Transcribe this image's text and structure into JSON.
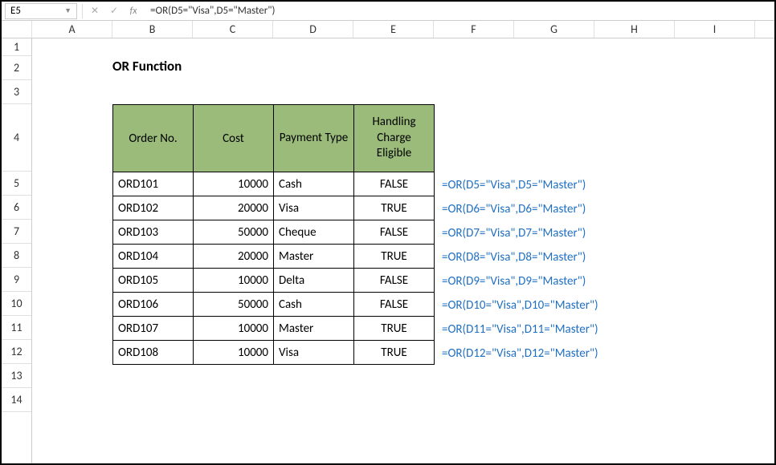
{
  "formulaBar": {
    "nameBox": "E5",
    "formula": "=OR(D5=\"Visa\",D5=\"Master\")"
  },
  "columns": [
    "A",
    "B",
    "C",
    "D",
    "E",
    "F",
    "G",
    "H",
    "I"
  ],
  "rows": [
    "1",
    "2",
    "3",
    "4",
    "5",
    "6",
    "7",
    "8",
    "9",
    "10",
    "11",
    "12",
    "13",
    "14"
  ],
  "title": "OR Function",
  "table": {
    "headers": {
      "orderNo": "Order No.",
      "cost": "Cost",
      "paymentType": "Payment Type",
      "handlingCharge": "Handling Charge Eligible"
    },
    "rows": [
      {
        "orderNo": "ORD101",
        "cost": "10000",
        "paymentType": "Cash",
        "eligible": "FALSE",
        "formula": "=OR(D5=\"Visa\",D5=\"Master\")"
      },
      {
        "orderNo": "ORD102",
        "cost": "20000",
        "paymentType": "Visa",
        "eligible": "TRUE",
        "formula": "=OR(D6=\"Visa\",D6=\"Master\")"
      },
      {
        "orderNo": "ORD103",
        "cost": "50000",
        "paymentType": "Cheque",
        "eligible": "FALSE",
        "formula": "=OR(D7=\"Visa\",D7=\"Master\")"
      },
      {
        "orderNo": "ORD104",
        "cost": "20000",
        "paymentType": "Master",
        "eligible": "TRUE",
        "formula": "=OR(D8=\"Visa\",D8=\"Master\")"
      },
      {
        "orderNo": "ORD105",
        "cost": "10000",
        "paymentType": "Delta",
        "eligible": "FALSE",
        "formula": "=OR(D9=\"Visa\",D9=\"Master\")"
      },
      {
        "orderNo": "ORD106",
        "cost": "50000",
        "paymentType": "Cash",
        "eligible": "FALSE",
        "formula": "=OR(D10=\"Visa\",D10=\"Master\")"
      },
      {
        "orderNo": "ORD107",
        "cost": "10000",
        "paymentType": "Master",
        "eligible": "TRUE",
        "formula": "=OR(D11=\"Visa\",D11=\"Master\")"
      },
      {
        "orderNo": "ORD108",
        "cost": "10000",
        "paymentType": "Visa",
        "eligible": "TRUE",
        "formula": "=OR(D12=\"Visa\",D12=\"Master\")"
      }
    ]
  }
}
